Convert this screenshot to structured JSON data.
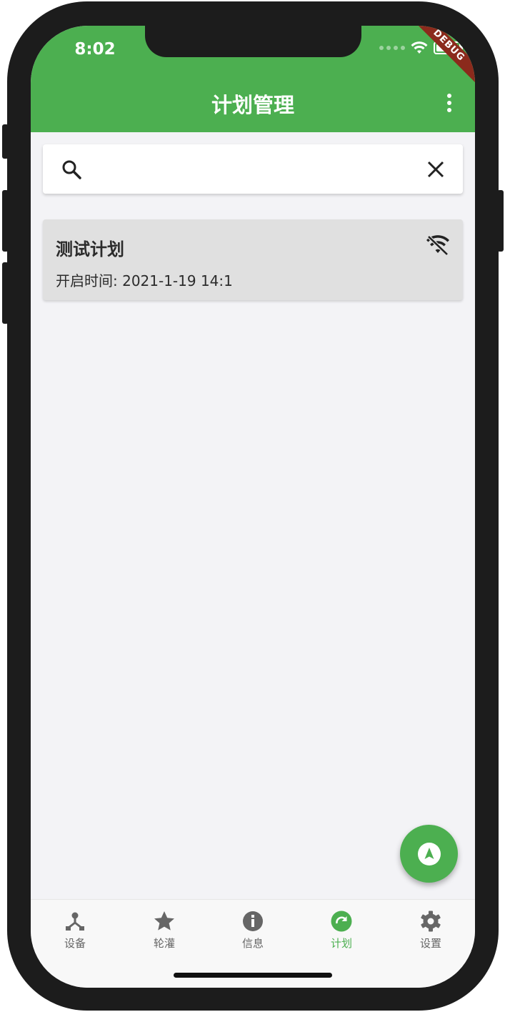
{
  "status_bar": {
    "time": "8:02",
    "debug_label": "DEBUG"
  },
  "app_bar": {
    "title": "计划管理",
    "menu_icon": "more-vert-icon"
  },
  "search": {
    "value": "",
    "placeholder": "",
    "search_icon": "search-icon",
    "clear_icon": "close-icon"
  },
  "plans": [
    {
      "name": "测试计划",
      "start_time": "开启时间: 2021-1-19 14:1",
      "status_icon": "wifi-off-icon"
    }
  ],
  "fab": {
    "icon": "navigation-icon"
  },
  "bottom_nav": {
    "items": [
      {
        "label": "设备",
        "icon": "device-hub-icon"
      },
      {
        "label": "轮灌",
        "icon": "star-icon"
      },
      {
        "label": "信息",
        "icon": "info-icon"
      },
      {
        "label": "计划",
        "icon": "refresh-icon"
      },
      {
        "label": "设置",
        "icon": "gear-icon"
      }
    ],
    "active_index": 3
  },
  "colors": {
    "primary": "#4caf50",
    "background": "#f3f3f6",
    "card": "#e0e0e0",
    "debug": "#8b2a1c"
  }
}
